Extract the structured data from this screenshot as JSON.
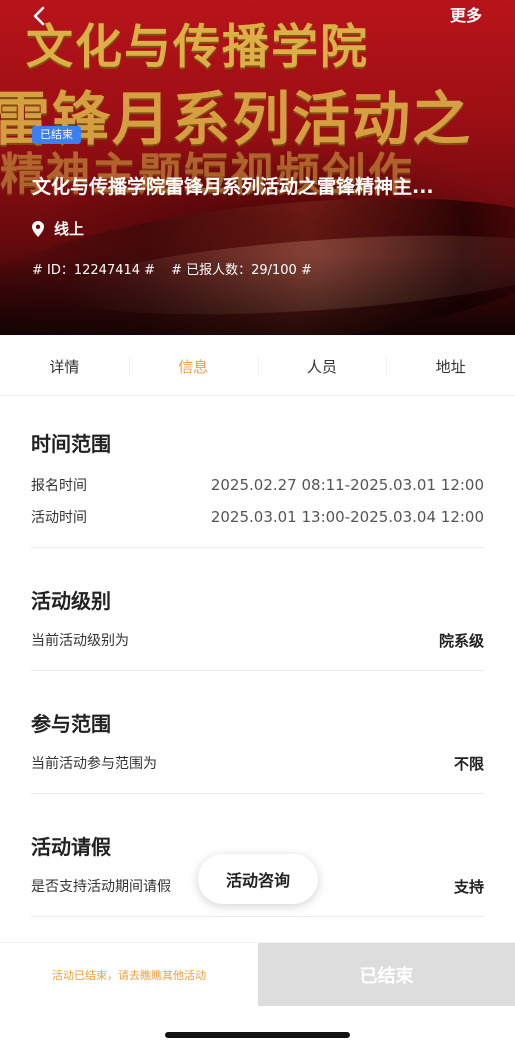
{
  "header": {
    "more_label": "更多",
    "banner_lines": [
      "文化与传播学院",
      "雷锋月系列活动之",
      "精神主题短视频创作"
    ]
  },
  "event": {
    "status": "已结束",
    "title": "文化与传播学院雷锋月系列活动之雷锋精神主...",
    "location": "线上",
    "tags": [
      "# ID：12247414 #",
      "# 已报人数：29/100 #"
    ]
  },
  "tabs": [
    {
      "label": "详情",
      "active": false
    },
    {
      "label": "信息",
      "active": true
    },
    {
      "label": "人员",
      "active": false
    },
    {
      "label": "地址",
      "active": false
    }
  ],
  "sections": {
    "time_range": {
      "title": "时间范围",
      "rows": [
        {
          "label": "报名时间",
          "value": "2025.02.27 08:11-2025.03.01 12:00"
        },
        {
          "label": "活动时间",
          "value": "2025.03.01 13:00-2025.03.04 12:00"
        }
      ]
    },
    "level": {
      "title": "活动级别",
      "label": "当前活动级别为",
      "value": "院系级"
    },
    "scope": {
      "title": "参与范围",
      "label": "当前活动参与范围为",
      "value": "不限"
    },
    "leave": {
      "title": "活动请假",
      "label": "是否支持活动期间请假",
      "value": "支持"
    }
  },
  "consult_button": "活动咨询",
  "bottom": {
    "note": "活动已结束，请去瞧瞧其他活动",
    "button": "已结束"
  },
  "colors": {
    "accent": "#f0a03c",
    "badge": "#3d7ff0",
    "banner_red": "#b8141a",
    "banner_gold": "#e0b94a",
    "disabled": "#dddddd"
  }
}
